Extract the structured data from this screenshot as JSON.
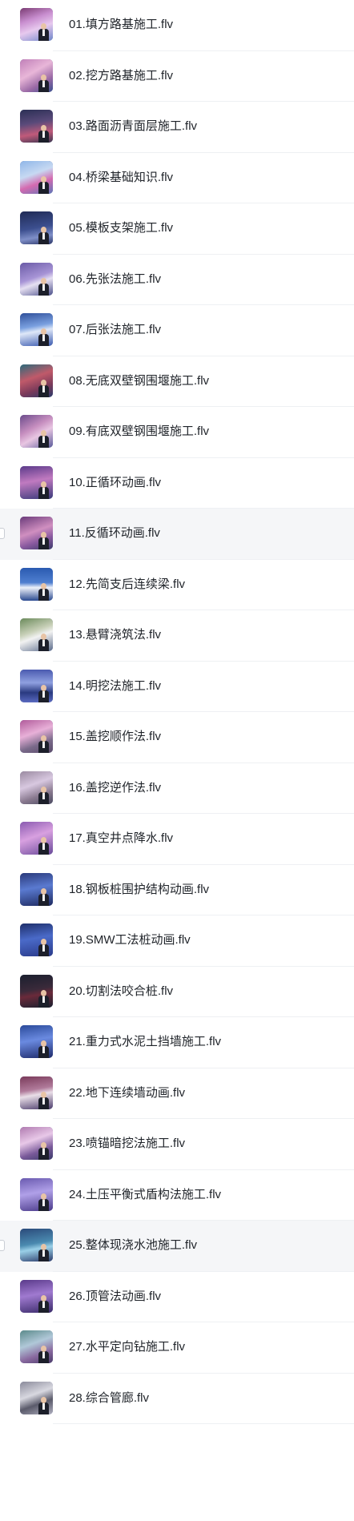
{
  "files": [
    {
      "name": "01.填方路基施工.flv",
      "scene": "linear-gradient(160deg,#7a3a72 0%,#c98fd0 35%,#e7c9ee 60%,#6d86c9 100%)"
    },
    {
      "name": "02.挖方路基施工.flv",
      "scene": "linear-gradient(150deg,#c07fb8 0%,#e8b6d8 40%,#9b6aa6 70%,#3a4f8f 100%)"
    },
    {
      "name": "03.路面沥青面层施工.flv",
      "scene": "linear-gradient(170deg,#2b2f55 0%,#5a4a7a 40%,#c05a7a 70%,#3a3550 100%)"
    },
    {
      "name": "04.桥梁基础知识.flv",
      "scene": "linear-gradient(160deg,#8fb6e8 0%,#c7d9f2 40%,#d46ab0 65%,#5d76b8 100%)"
    },
    {
      "name": "05.模板支架施工.flv",
      "scene": "linear-gradient(170deg,#1f2a55 0%,#3c4f8f 50%,#7f8fc8 75%,#2a3566 100%)"
    },
    {
      "name": "06.先张法施工.flv",
      "scene": "linear-gradient(160deg,#6a5aa6 0%,#a794d6 45%,#e6e0f2 60%,#4b4f8a 100%)"
    },
    {
      "name": "07.后张法施工.flv",
      "scene": "linear-gradient(170deg,#2f4f9a 0%,#7aa0e0 40%,#dfe8f8 55%,#3a5ab0 100%)"
    },
    {
      "name": "08.无底双壁钢围堰施工.flv",
      "scene": "linear-gradient(160deg,#2a6a7a 0%,#c05a6a 40%,#7a3a5a 70%,#2a3a6a 100%)"
    },
    {
      "name": "09.有底双壁钢围堰施工.flv",
      "scene": "linear-gradient(150deg,#6a4a8a 0%,#c78fc0 40%,#e8c6e2 60%,#5a5a9a 100%)"
    },
    {
      "name": "10.正循环动画.flv",
      "scene": "linear-gradient(170deg,#5a3a8a 0%,#c07ac0 45%,#3a3a7a 100%)"
    },
    {
      "name": "11.反循环动画.flv",
      "scene": "linear-gradient(160deg,#6a3a7a 0%,#d08fc0 45%,#8a5aa0 70%,#3a3a6a 100%)"
    },
    {
      "name": "12.先简支后连续梁.flv",
      "scene": "linear-gradient(180deg,#2a5ab0 0%,#4f7fd0 45%,#eef2fa 60%,#2a4a90 100%)"
    },
    {
      "name": "13.悬臂浇筑法.flv",
      "scene": "linear-gradient(160deg,#6a8a5a 0%,#c8d0b8 40%,#f2f2f2 55%,#5a6a8a 100%)"
    },
    {
      "name": "14.明挖法施工.flv",
      "scene": "linear-gradient(180deg,#4a5ab0 0%,#8fa0e0 40%,#2a3a80 70%,#5a6ac0 100%)"
    },
    {
      "name": "15.盖挖顺作法.flv",
      "scene": "linear-gradient(160deg,#b05a9a 0%,#e8b0d8 40%,#7a6a8a 70%,#5a4a6a 100%)"
    },
    {
      "name": "16.盖挖逆作法.flv",
      "scene": "linear-gradient(160deg,#9a8aa0 0%,#d8c8e0 40%,#8a7a90 70%,#4a4a60 100%)"
    },
    {
      "name": "17.真空井点降水.flv",
      "scene": "linear-gradient(160deg,#8a5ab0 0%,#d8a0e0 45%,#6a4a9a 100%)"
    },
    {
      "name": "18.钢板桩围护结构动画.flv",
      "scene": "linear-gradient(170deg,#2a3a7a 0%,#5a7ad0 45%,#1e2a60 100%)"
    },
    {
      "name": "19.SMW工法桩动画.flv",
      "scene": "linear-gradient(170deg,#1e2f6a 0%,#4a6ac8 45%,#2a3a8a 100%)"
    },
    {
      "name": "20.切割法咬合桩.flv",
      "scene": "linear-gradient(170deg,#1a1f2e 0%,#3a2a3a 45%,#6a2a3a 60%,#1a1f2e 100%)"
    },
    {
      "name": "21.重力式水泥土挡墙施工.flv",
      "scene": "linear-gradient(170deg,#2a4a9a 0%,#6a8ae0 45%,#1e2a6a 100%)"
    },
    {
      "name": "22.地下连续墙动画.flv",
      "scene": "linear-gradient(170deg,#7a3a5a 0%,#b07a9a 40%,#eadfe8 55%,#4a3a6a 100%)"
    },
    {
      "name": "23.喷锚暗挖法施工.flv",
      "scene": "linear-gradient(160deg,#b07ab0 0%,#e8c8e8 40%,#7a5a9a 70%,#3a3a6a 100%)"
    },
    {
      "name": "24.土压平衡式盾构法施工.flv",
      "scene": "linear-gradient(170deg,#6a5ab0 0%,#b0a0e8 45%,#4a3a8a 100%)"
    },
    {
      "name": "25.整体现浇水池施工.flv",
      "scene": "linear-gradient(170deg,#2a4a7a 0%,#4a8ab0 45%,#9ad0e8 60%,#2a3a6a 100%)"
    },
    {
      "name": "26.顶管法动画.flv",
      "scene": "linear-gradient(170deg,#5a3a8a 0%,#a07ad0 45%,#3a2a6a 100%)"
    },
    {
      "name": "27.水平定向钻施工.flv",
      "scene": "linear-gradient(160deg,#5a8a8a 0%,#b0c8d8 40%,#8a6aa0 70%,#4a3a6a 100%)"
    },
    {
      "name": "28.综合管廊.flv",
      "scene": "linear-gradient(160deg,#8a8a9a 0%,#d8d8e0 40%,#5a5a6a 65%,#b0b0c0 100%)"
    }
  ],
  "hovered_rows": [
    10,
    24
  ]
}
